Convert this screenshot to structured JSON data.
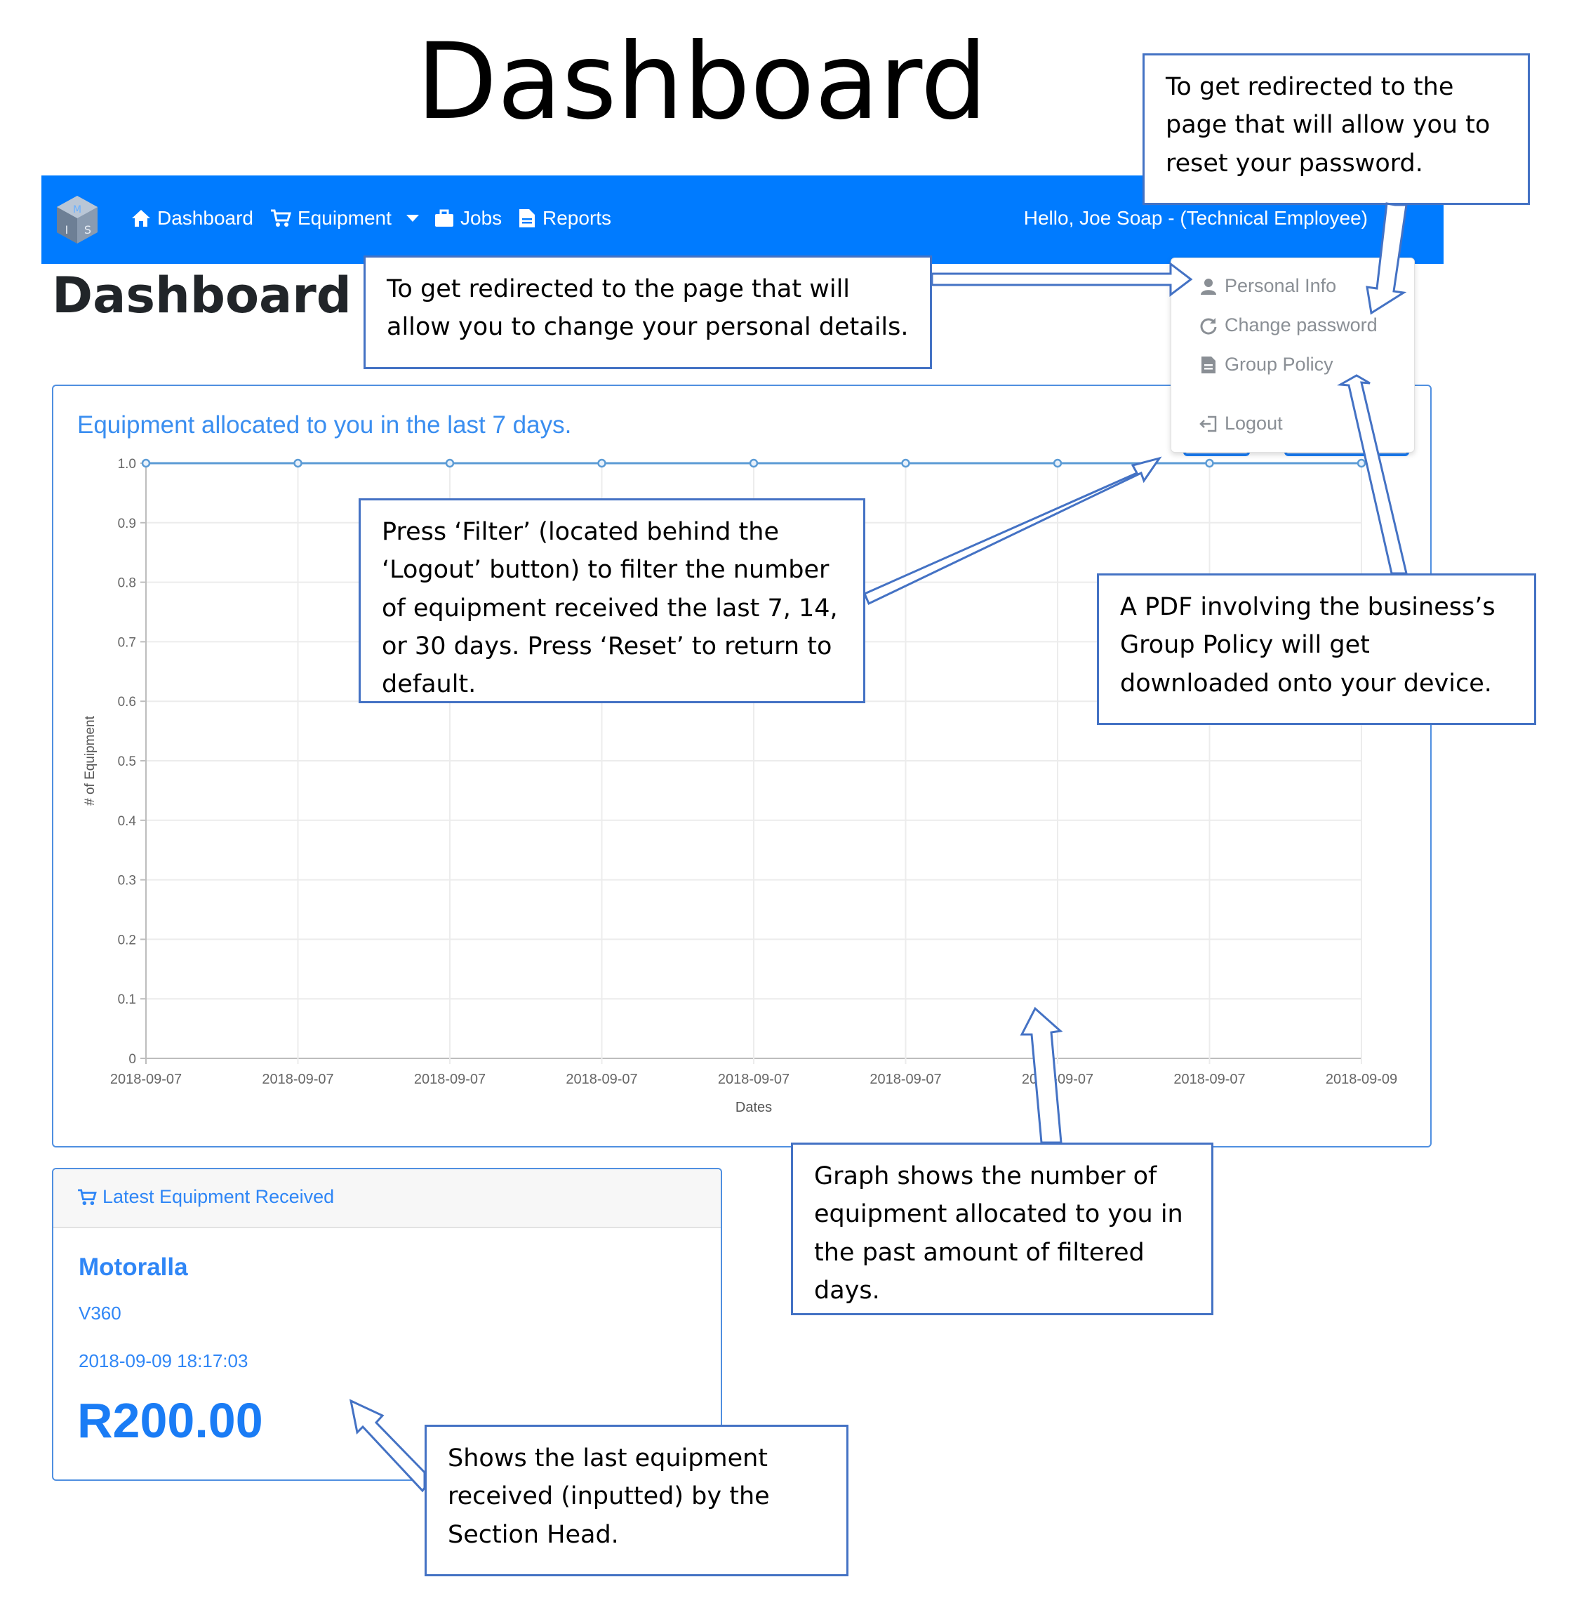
{
  "document": {
    "title": "Dashboard"
  },
  "navbar": {
    "logo": "MIS",
    "items": [
      {
        "label": "Dashboard",
        "icon": "home-icon"
      },
      {
        "label": "Equipment",
        "icon": "cart-icon",
        "dropdown": true
      },
      {
        "label": "Jobs",
        "icon": "briefcase-icon"
      },
      {
        "label": "Reports",
        "icon": "report-icon"
      }
    ],
    "greeting": "Hello, Joe Soap - (Technical Employee)"
  },
  "page": {
    "title": "Dashboard"
  },
  "user_menu": {
    "items": [
      {
        "label": "Personal Info",
        "icon": "user-icon"
      },
      {
        "label": "Change password",
        "icon": "refresh-icon"
      },
      {
        "label": "Group Policy",
        "icon": "document-icon"
      },
      {
        "label": "Logout",
        "icon": "logout-icon"
      }
    ]
  },
  "chart_card": {
    "title": "Equipment allocated to you in the last 7 days."
  },
  "chart_data": {
    "type": "line",
    "title": "Equipment allocated to you in the last 7 days.",
    "xlabel": "Dates",
    "ylabel": "# of Equipment",
    "ylim": [
      0,
      1.0
    ],
    "yticks": [
      "0",
      "0.1",
      "0.2",
      "0.3",
      "0.4",
      "0.5",
      "0.6",
      "0.7",
      "0.8",
      "0.9",
      "1.0"
    ],
    "categories": [
      "2018-09-07",
      "2018-09-07",
      "2018-09-07",
      "2018-09-07",
      "2018-09-07",
      "2018-09-07",
      "2018-09-07",
      "2018-09-07",
      "2018-09-09"
    ],
    "series": [
      {
        "values": [
          1,
          1,
          1,
          1,
          1,
          1,
          1,
          1,
          1
        ]
      }
    ],
    "grid": true,
    "color": "#5b9bd5"
  },
  "latest_equipment": {
    "header": "Latest Equipment Received",
    "name": "Motoralla",
    "model": "V360",
    "datetime": "2018-09-09 18:17:03",
    "price": "R200.00"
  },
  "callouts": {
    "reset_password": "To get redirected to the page that will allow you to reset your password.",
    "personal_details": "To get redirected to the page that will allow you to change your personal details.",
    "filter": "Press ‘Filter’ (located behind the ‘Logout’ button) to filter the number of equipment received the last 7, 14, or 30 days. Press ‘Reset’ to return to default.",
    "group_policy": "A PDF involving the business’s Group Policy will get downloaded onto your device.",
    "graph": "Graph shows the number of equipment allocated to you in the past amount of filtered days.",
    "latest": "Shows the last equipment received (inputted) by the Section Head."
  },
  "colors": {
    "navbar": "#007bff",
    "accent": "#3a8ef0",
    "callout_border": "#4472c4"
  }
}
